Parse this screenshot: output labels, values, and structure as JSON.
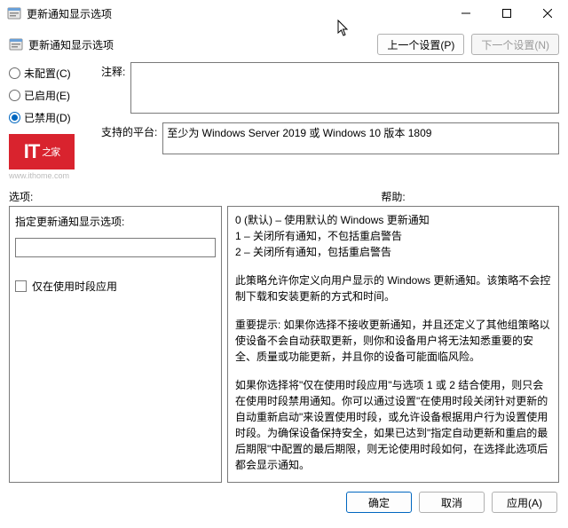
{
  "window": {
    "title": "更新通知显示选项"
  },
  "toolbar": {
    "title": "更新通知显示选项",
    "prev_label": "上一个设置(P)",
    "next_label": "下一个设置(N)"
  },
  "radios": {
    "not_configured": "未配置(C)",
    "enabled": "已启用(E)",
    "disabled": "已禁用(D)",
    "selected": "disabled"
  },
  "logo": {
    "main": "IT",
    "zh": "之家",
    "url": "www.ithome.com"
  },
  "comment": {
    "label": "注释:"
  },
  "platform": {
    "label": "支持的平台:",
    "value": "至少为 Windows Server 2019 或 Windows 10 版本 1809"
  },
  "sections": {
    "options_label": "选项:",
    "help_label": "帮助:"
  },
  "options": {
    "field_label": "指定更新通知显示选项:",
    "field_value": "",
    "checkbox_label": "仅在使用时段应用",
    "checkbox_checked": false
  },
  "help": {
    "line0": "0 (默认) – 使用默认的 Windows 更新通知",
    "line1": "1 – 关闭所有通知，不包括重启警告",
    "line2": "2 – 关闭所有通知，包括重启警告",
    "para1": "此策略允许你定义向用户显示的 Windows 更新通知。该策略不会控制下载和安装更新的方式和时间。",
    "para2": "重要提示: 如果你选择不接收更新通知，并且还定义了其他组策略以使设备不会自动获取更新，则你和设备用户将无法知悉重要的安全、质量或功能更新，并且你的设备可能面临风险。",
    "para3": "如果你选择将\"仅在使用时段应用\"与选项 1 或 2 结合使用，则只会在使用时段禁用通知。你可以通过设置\"在使用时段关闭针对更新的自动重新启动\"来设置使用时段，或允许设备根据用户行为设置使用时段。为确保设备保持安全，如果已达到\"指定自动更新和重启的最后期限\"中配置的最后期限，则无论使用时段如何，在选择此选项后都会显示通知。"
  },
  "buttons": {
    "ok": "确定",
    "cancel": "取消",
    "apply": "应用(A)"
  }
}
